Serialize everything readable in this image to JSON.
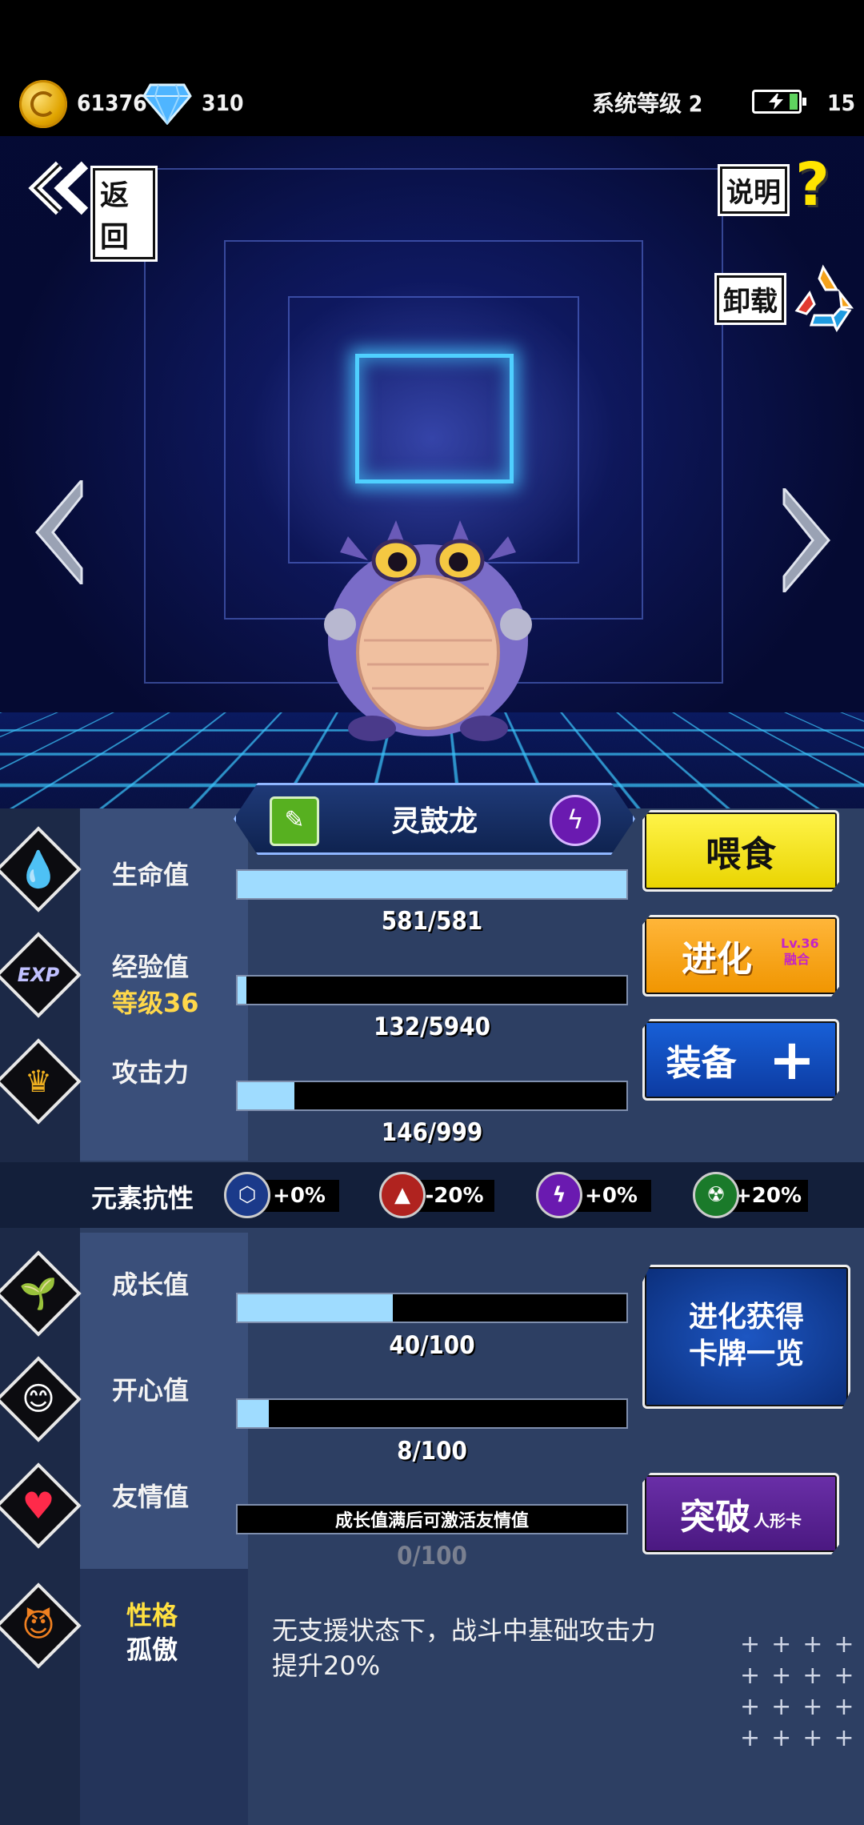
{
  "status_bar": {
    "coins": "61376",
    "gems": "310",
    "system_level": "系统等级 2",
    "energy": "15"
  },
  "nav": {
    "back_label": "返回",
    "help_label": "说明",
    "help_mark": "?",
    "uninstall_label": "卸载"
  },
  "pet": {
    "name": "灵鼓龙",
    "element_icon": "lightning-icon"
  },
  "stats": {
    "hp": {
      "label": "生命值",
      "text": "581/581",
      "value": 581,
      "max": 581
    },
    "exp": {
      "label": "经验值",
      "level": "等级36",
      "text": "132/5940",
      "value": 132,
      "max": 5940
    },
    "attack": {
      "label": "攻击力",
      "text": "146/999",
      "value": 146,
      "max": 999
    },
    "growth": {
      "label": "成长值",
      "text": "40/100",
      "value": 40,
      "max": 100
    },
    "happy": {
      "label": "开心值",
      "text": "8/100",
      "value": 8,
      "max": 100
    },
    "friendship": {
      "label": "友情值",
      "note": "成长值满后可激活友情值",
      "text": "0/100",
      "value": 0,
      "max": 100
    }
  },
  "elements": {
    "label": "元素抗性",
    "items": [
      {
        "icon": "hexagon-icon",
        "value": "+0%",
        "color": "#1b3a8a"
      },
      {
        "icon": "fire-triangle-icon",
        "value": "-20%",
        "color": "#b0231f"
      },
      {
        "icon": "lightning-icon",
        "value": "+0%",
        "color": "#6a1ab0"
      },
      {
        "icon": "radiation-icon",
        "value": "+20%",
        "color": "#1a7a2a"
      }
    ]
  },
  "buttons": {
    "feed": "喂食",
    "evolve": "进化",
    "evolve_tag_level": "Lv.36",
    "evolve_tag_sub": "融合",
    "equip": "装备",
    "equip_plus": "+",
    "card_list_line1": "进化获得",
    "card_list_line2": "卡牌一览",
    "breakthrough": "突破",
    "breakthrough_sub": "人形卡"
  },
  "personality": {
    "label": "性格",
    "value": "孤傲",
    "description": "无支援状态下，战斗中基础攻击力提升20%"
  },
  "colors": {
    "panel": "#2d3f63",
    "feed": "#f4e51c",
    "evolve": "#f5a21a",
    "equip": "#1450c0",
    "breakthrough": "#5a2292",
    "bar_fill": "#9fdcff"
  }
}
